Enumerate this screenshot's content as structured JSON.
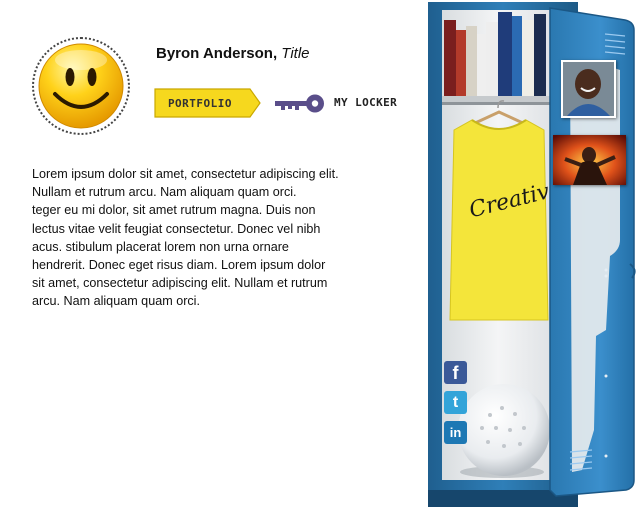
{
  "profile": {
    "name": "Byron Anderson,",
    "title": "Title",
    "avatar_icon": "smiley-face-icon"
  },
  "nav": {
    "portfolio_label": "PORTFOLIO",
    "my_locker_label": "MY LOCKER",
    "key_icon": "key-icon"
  },
  "bio": {
    "text": "Lorem ipsum dolor sit amet, consectetur adipiscing elit.\nNullam et rutrum arcu. Nam aliquam quam orci.\nteger eu mi dolor, sit amet rutrum magna. Duis non\nlectus vitae velit feugiat consectetur. Donec vel nibh\nacus. stibulum placerat lorem non urna ornare\n hendrerit. Donec eget risus diam. Lorem ipsum dolor\nsit amet, consectetur adipiscing elit. Nullam et rutrum\narcu. Nam aliquam quam orci."
  },
  "locker": {
    "shirt_text": "Creative",
    "social": {
      "facebook": "f",
      "twitter": "t",
      "linkedin": "in"
    }
  },
  "colors": {
    "locker_blue": "#2f7fb8",
    "button_yellow": "#f6d81e",
    "key_purple": "#5a4e8a",
    "shirt_yellow": "#f4e53a"
  }
}
